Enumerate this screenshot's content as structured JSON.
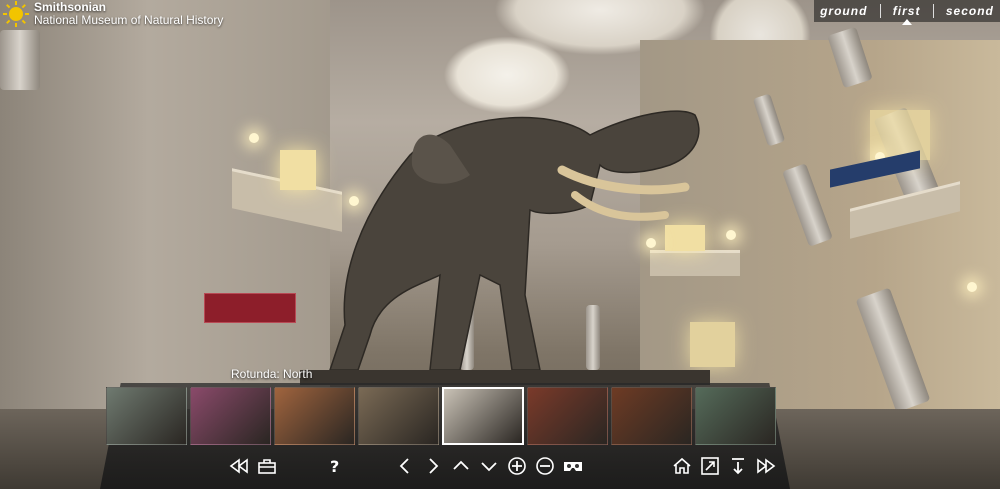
{
  "logo": {
    "line1": "Smithsonian",
    "line2": "National Museum of Natural History"
  },
  "floors": {
    "items": [
      {
        "label": "ground",
        "active": false
      },
      {
        "label": "first",
        "active": true
      },
      {
        "label": "second",
        "active": false
      }
    ]
  },
  "location": {
    "label": "Rotunda: North"
  },
  "thumbnails": {
    "active_index": 4,
    "colors": [
      "#6f7a70",
      "#8a4a6a",
      "#a0643e",
      "#7a6a55",
      "#c9c2b6",
      "#7a3a2a",
      "#6e3b24",
      "#556b5a"
    ]
  },
  "controls": {
    "icons": [
      "rewind-icon",
      "toolbox-icon",
      "help-icon",
      "left-icon",
      "right-icon",
      "up-icon",
      "down-icon",
      "zoom-in-icon",
      "zoom-out-icon",
      "vr-icon",
      "home-icon",
      "fullscreen-icon",
      "download-icon",
      "fast-forward-icon"
    ]
  },
  "colors": {
    "logo_sun": "#f2c400",
    "accent": "#ffffff"
  }
}
